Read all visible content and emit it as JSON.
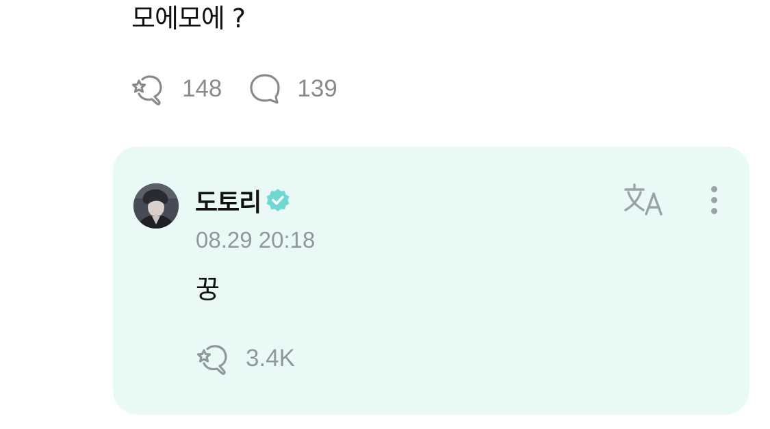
{
  "post": {
    "text": "모에모에 ?",
    "like_count": "148",
    "comment_count": "139"
  },
  "reply": {
    "author": "도토리",
    "verified": true,
    "timestamp": "08.29 20:18",
    "text": "꿍",
    "like_count": "3.4K"
  },
  "colors": {
    "card_bg": "#e9f9f6",
    "verified_badge": "#6fd8d3",
    "muted_text": "#8a8a8a"
  },
  "icons": {
    "like": "heart-hand-icon",
    "comment": "speech-bubble-icon",
    "translate": "translate-icon",
    "more": "more-vertical-icon",
    "verified": "verified-badge-icon"
  }
}
